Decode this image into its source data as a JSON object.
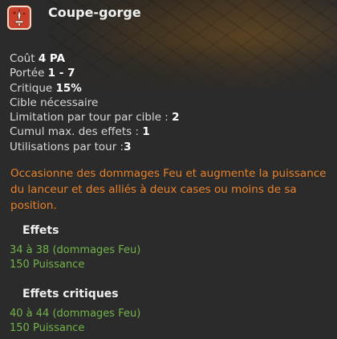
{
  "spell": {
    "name": "Coupe-gorge",
    "icon": "bloody-dagger-icon",
    "icon_color": "#c9412d"
  },
  "stats": {
    "cost_label": "Coût",
    "cost_value": "4 PA",
    "range_label": "Portée",
    "range_value": "1 - 7",
    "crit_label": "Critique",
    "crit_value": "15%",
    "target_required": "Cible nécessaire",
    "per_target_label": "Limitation par tour par cible :",
    "per_target_value": "2",
    "cumul_label": "Cumul max. des effets :",
    "cumul_value": "1",
    "uses_label": "Utilisations par tour :",
    "uses_value": "3"
  },
  "description": "Occasionne des dommages Feu et augmente la puissance du lanceur et des alliés à deux cases ou moins de sa position.",
  "effects": {
    "title": "Effets",
    "items": [
      {
        "value": "34 à 38",
        "text": "(dommages Feu)"
      },
      {
        "value": "150",
        "text": "Puissance"
      }
    ]
  },
  "critical_effects": {
    "title": "Effets critiques",
    "items": [
      {
        "value": "40 à 44",
        "text": "(dommages Feu)"
      },
      {
        "value": "150",
        "text": "Puissance"
      }
    ]
  },
  "colors": {
    "description": "#e8822a",
    "effect": "#73b34a",
    "background": "#2b2b2b"
  }
}
